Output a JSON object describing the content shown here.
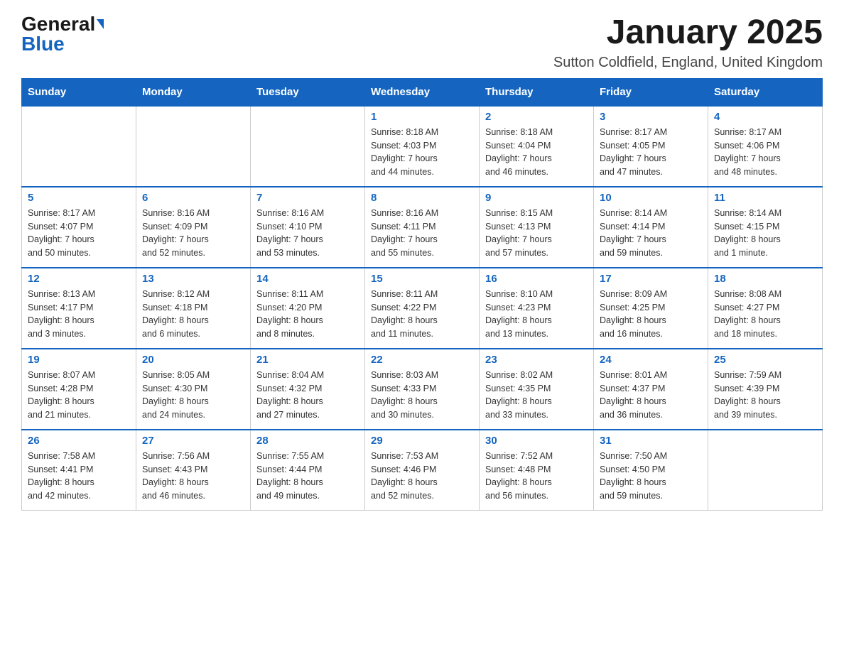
{
  "header": {
    "logo_general": "General",
    "logo_blue": "Blue",
    "title": "January 2025",
    "subtitle": "Sutton Coldfield, England, United Kingdom"
  },
  "days_of_week": [
    "Sunday",
    "Monday",
    "Tuesday",
    "Wednesday",
    "Thursday",
    "Friday",
    "Saturday"
  ],
  "weeks": [
    [
      {
        "day": "",
        "info": ""
      },
      {
        "day": "",
        "info": ""
      },
      {
        "day": "",
        "info": ""
      },
      {
        "day": "1",
        "info": "Sunrise: 8:18 AM\nSunset: 4:03 PM\nDaylight: 7 hours\nand 44 minutes."
      },
      {
        "day": "2",
        "info": "Sunrise: 8:18 AM\nSunset: 4:04 PM\nDaylight: 7 hours\nand 46 minutes."
      },
      {
        "day": "3",
        "info": "Sunrise: 8:17 AM\nSunset: 4:05 PM\nDaylight: 7 hours\nand 47 minutes."
      },
      {
        "day": "4",
        "info": "Sunrise: 8:17 AM\nSunset: 4:06 PM\nDaylight: 7 hours\nand 48 minutes."
      }
    ],
    [
      {
        "day": "5",
        "info": "Sunrise: 8:17 AM\nSunset: 4:07 PM\nDaylight: 7 hours\nand 50 minutes."
      },
      {
        "day": "6",
        "info": "Sunrise: 8:16 AM\nSunset: 4:09 PM\nDaylight: 7 hours\nand 52 minutes."
      },
      {
        "day": "7",
        "info": "Sunrise: 8:16 AM\nSunset: 4:10 PM\nDaylight: 7 hours\nand 53 minutes."
      },
      {
        "day": "8",
        "info": "Sunrise: 8:16 AM\nSunset: 4:11 PM\nDaylight: 7 hours\nand 55 minutes."
      },
      {
        "day": "9",
        "info": "Sunrise: 8:15 AM\nSunset: 4:13 PM\nDaylight: 7 hours\nand 57 minutes."
      },
      {
        "day": "10",
        "info": "Sunrise: 8:14 AM\nSunset: 4:14 PM\nDaylight: 7 hours\nand 59 minutes."
      },
      {
        "day": "11",
        "info": "Sunrise: 8:14 AM\nSunset: 4:15 PM\nDaylight: 8 hours\nand 1 minute."
      }
    ],
    [
      {
        "day": "12",
        "info": "Sunrise: 8:13 AM\nSunset: 4:17 PM\nDaylight: 8 hours\nand 3 minutes."
      },
      {
        "day": "13",
        "info": "Sunrise: 8:12 AM\nSunset: 4:18 PM\nDaylight: 8 hours\nand 6 minutes."
      },
      {
        "day": "14",
        "info": "Sunrise: 8:11 AM\nSunset: 4:20 PM\nDaylight: 8 hours\nand 8 minutes."
      },
      {
        "day": "15",
        "info": "Sunrise: 8:11 AM\nSunset: 4:22 PM\nDaylight: 8 hours\nand 11 minutes."
      },
      {
        "day": "16",
        "info": "Sunrise: 8:10 AM\nSunset: 4:23 PM\nDaylight: 8 hours\nand 13 minutes."
      },
      {
        "day": "17",
        "info": "Sunrise: 8:09 AM\nSunset: 4:25 PM\nDaylight: 8 hours\nand 16 minutes."
      },
      {
        "day": "18",
        "info": "Sunrise: 8:08 AM\nSunset: 4:27 PM\nDaylight: 8 hours\nand 18 minutes."
      }
    ],
    [
      {
        "day": "19",
        "info": "Sunrise: 8:07 AM\nSunset: 4:28 PM\nDaylight: 8 hours\nand 21 minutes."
      },
      {
        "day": "20",
        "info": "Sunrise: 8:05 AM\nSunset: 4:30 PM\nDaylight: 8 hours\nand 24 minutes."
      },
      {
        "day": "21",
        "info": "Sunrise: 8:04 AM\nSunset: 4:32 PM\nDaylight: 8 hours\nand 27 minutes."
      },
      {
        "day": "22",
        "info": "Sunrise: 8:03 AM\nSunset: 4:33 PM\nDaylight: 8 hours\nand 30 minutes."
      },
      {
        "day": "23",
        "info": "Sunrise: 8:02 AM\nSunset: 4:35 PM\nDaylight: 8 hours\nand 33 minutes."
      },
      {
        "day": "24",
        "info": "Sunrise: 8:01 AM\nSunset: 4:37 PM\nDaylight: 8 hours\nand 36 minutes."
      },
      {
        "day": "25",
        "info": "Sunrise: 7:59 AM\nSunset: 4:39 PM\nDaylight: 8 hours\nand 39 minutes."
      }
    ],
    [
      {
        "day": "26",
        "info": "Sunrise: 7:58 AM\nSunset: 4:41 PM\nDaylight: 8 hours\nand 42 minutes."
      },
      {
        "day": "27",
        "info": "Sunrise: 7:56 AM\nSunset: 4:43 PM\nDaylight: 8 hours\nand 46 minutes."
      },
      {
        "day": "28",
        "info": "Sunrise: 7:55 AM\nSunset: 4:44 PM\nDaylight: 8 hours\nand 49 minutes."
      },
      {
        "day": "29",
        "info": "Sunrise: 7:53 AM\nSunset: 4:46 PM\nDaylight: 8 hours\nand 52 minutes."
      },
      {
        "day": "30",
        "info": "Sunrise: 7:52 AM\nSunset: 4:48 PM\nDaylight: 8 hours\nand 56 minutes."
      },
      {
        "day": "31",
        "info": "Sunrise: 7:50 AM\nSunset: 4:50 PM\nDaylight: 8 hours\nand 59 minutes."
      },
      {
        "day": "",
        "info": ""
      }
    ]
  ]
}
